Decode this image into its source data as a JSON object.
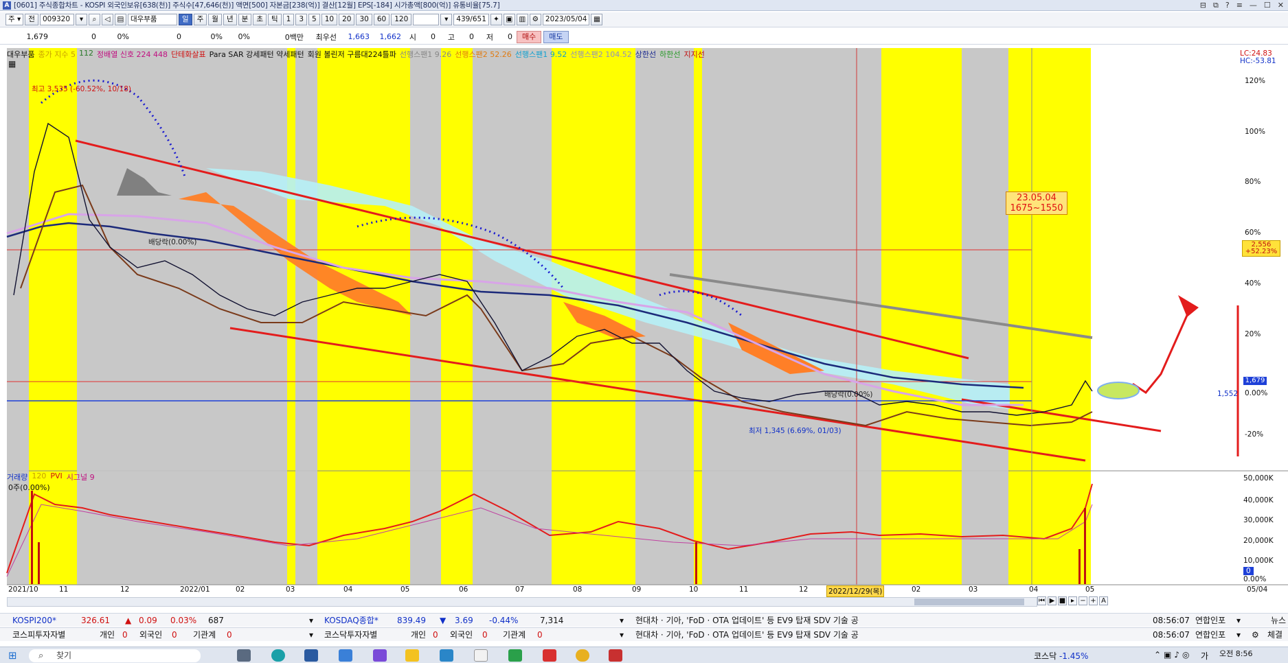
{
  "titlebar": {
    "icon": "A",
    "text": "[0601] 주식종합차트 - KOSPI 외국인보유[638(천)] 주식수[47,646(천)] 액면[500] 자본금[238(억)] 결산[12월] EPS[-184] 시가총액[800(억)] 유통비율[75.7]"
  },
  "toolbar": {
    "mode": "주",
    "prev_label": "전",
    "code": "009320",
    "stock_name": "대우부품",
    "periods": [
      "일",
      "주",
      "월",
      "년",
      "분",
      "초",
      "틱"
    ],
    "selected_period": "일",
    "intervals": [
      "1",
      "3",
      "5",
      "10",
      "20",
      "30",
      "60",
      "120"
    ],
    "count": "439/651",
    "date": "2023/05/04"
  },
  "quote": {
    "price": "1,679",
    "change": "0",
    "change_pct": "0%",
    "volume": "0",
    "vol_pct": "0%",
    "vol_pct2": "0%",
    "amount": "0백만",
    "best_ask_label": "최우선",
    "best_ask": "1,663",
    "best_bid": "1,662",
    "open_label": "시",
    "open": "0",
    "high_label": "고",
    "high": "0",
    "low_label": "저",
    "low": "0",
    "buy_label": "매수",
    "sell_label": "매도"
  },
  "legend": [
    {
      "text": "대우부품",
      "color": "#111111"
    },
    {
      "text": "종가 지수 5",
      "color": "#c8a000"
    },
    {
      "text": "112",
      "color": "#2a7a2a"
    },
    {
      "text": "정배열 신호  224  448",
      "color": "#c01080"
    },
    {
      "text": "단테화살표",
      "color": "#d01010"
    },
    {
      "text": "Para SAR 강세패턴  약세패턴",
      "color": "#111111"
    },
    {
      "text": "회원 볼린저 구름대224틀파",
      "color": "#111111"
    },
    {
      "text": "선행스팬1 9.26",
      "color": "#888888"
    },
    {
      "text": "선행스팬2 52.26",
      "color": "#e07a10"
    },
    {
      "text": "선행스팬1 9.52",
      "color": "#10a0d0"
    },
    {
      "text": "선행스팬2 104.52",
      "color": "#9090c0"
    },
    {
      "text": "상한선",
      "color": "#1c2a90"
    },
    {
      "text": "하한선",
      "color": "#2a9a2a"
    },
    {
      "text": "지지선",
      "color": "#c01010"
    }
  ],
  "right_axis": {
    "top_left": "LC:24.83",
    "top_right": "HC:-53.81",
    "pct_labels": [
      "120%",
      "100%",
      "80%",
      "60%",
      "40%",
      "20%",
      "0.00%",
      "-20%"
    ],
    "mark_high_price": "2,556",
    "mark_high_pct": "+52.23%",
    "current_price": "1,679",
    "support_price": "1,552",
    "volume_labels": [
      "50,000K",
      "40,000K",
      "30,000K",
      "20,000K",
      "10,000K",
      "0",
      "0.00%"
    ]
  },
  "annotations": {
    "high": "최고 3,535 (-60.52%, 10/18)",
    "low": "최저 1,345 (6.69%, 01/03)",
    "dividend1": "배당락(0.00%)",
    "dividend2": "배당락(0.00%)",
    "target_date": "23.05.04",
    "target_range": "1675~1550"
  },
  "volume_legend": {
    "items": [
      {
        "text": "거래량",
        "color": "#1030c8"
      },
      {
        "text": "120",
        "color": "#c8a000"
      },
      {
        "text": "PVI",
        "color": "#d01010"
      },
      {
        "text": "시그널 9",
        "color": "#c01080"
      }
    ],
    "zero_label": "0주(0.00%)"
  },
  "x_axis": {
    "labels": [
      "2021/10",
      "11",
      "12",
      "2022/01",
      "02",
      "03",
      "04",
      "05",
      "06",
      "07",
      "08",
      "09",
      "10",
      "11",
      "12",
      "2022/12/29(목)",
      "02",
      "03",
      "04",
      "05",
      "05/04"
    ]
  },
  "ticker1": {
    "index_name": "KOSPI200*",
    "index_value": "326.61",
    "index_arrow": "▲",
    "index_change": "0.09",
    "index_pct": "0.03%",
    "index_vol": "687",
    "index2_name": "KOSDAQ종합*",
    "index2_value": "839.49",
    "index2_arrow": "▼",
    "index2_change": "3.69",
    "index2_pct": "-0.44%",
    "index2_vol": "7,314",
    "news": "현대차 · 기아, 'FoD · OTA 업데이트' 등 EV9 탑재 SDV 기술 공",
    "time": "08:56:07",
    "source": "연합인포",
    "more": "뉴스"
  },
  "ticker2": {
    "market1": "코스피투자자별",
    "individual": "개인",
    "individual_val": "0",
    "foreign": "외국인",
    "foreign_val": "0",
    "institution": "기관계",
    "institution_val": "0",
    "market2": "코스닥투자자별",
    "individual2_val": "0",
    "foreign2_val": "0",
    "institution2_val": "0",
    "news": "현대차 · 기아, 'FoD · OTA 업데이트' 등 EV9 탑재 SDV 기술 공",
    "time": "08:56:07",
    "source": "연합인포",
    "more": "체결"
  },
  "taskbar": {
    "search_placeholder": "찾기",
    "market_label": "코스닥",
    "market_pct": "-1.45%",
    "clock": "오전 8:56",
    "lang": "가"
  }
}
